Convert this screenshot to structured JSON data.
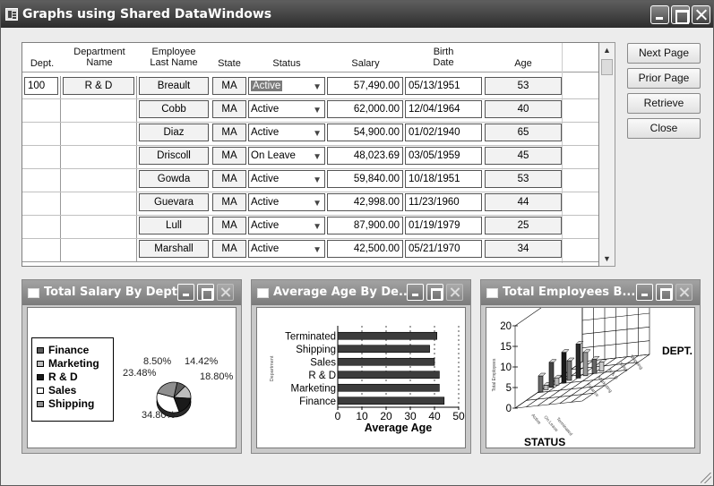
{
  "window": {
    "title": "Graphs using Shared DataWindows"
  },
  "grid": {
    "headers": {
      "dept": "Dept.",
      "department_name": [
        "Department",
        "Name"
      ],
      "employee_last_name": [
        "Employee",
        "Last Name"
      ],
      "state": "State",
      "status": "Status",
      "salary": "Salary",
      "birth_date": [
        "Birth",
        "Date"
      ],
      "age": "Age"
    },
    "dept_id": "100",
    "dept_name": "R & D",
    "rows": [
      {
        "last_name": "Breault",
        "state": "MA",
        "status": "Active",
        "salary": "57,490.00",
        "birth": "05/13/1951",
        "age": "53"
      },
      {
        "last_name": "Cobb",
        "state": "MA",
        "status": "Active",
        "salary": "62,000.00",
        "birth": "12/04/1964",
        "age": "40"
      },
      {
        "last_name": "Diaz",
        "state": "MA",
        "status": "Active",
        "salary": "54,900.00",
        "birth": "01/02/1940",
        "age": "65"
      },
      {
        "last_name": "Driscoll",
        "state": "MA",
        "status": "On Leave",
        "salary": "48,023.69",
        "birth": "03/05/1959",
        "age": "45"
      },
      {
        "last_name": "Gowda",
        "state": "MA",
        "status": "Active",
        "salary": "59,840.00",
        "birth": "10/18/1951",
        "age": "53"
      },
      {
        "last_name": "Guevara",
        "state": "MA",
        "status": "Active",
        "salary": "42,998.00",
        "birth": "11/23/1960",
        "age": "44"
      },
      {
        "last_name": "Lull",
        "state": "MA",
        "status": "Active",
        "salary": "87,900.00",
        "birth": "01/19/1979",
        "age": "25"
      },
      {
        "last_name": "Marshall",
        "state": "MA",
        "status": "Active",
        "salary": "42,500.00",
        "birth": "05/21/1970",
        "age": "34"
      }
    ]
  },
  "buttons": {
    "next_page": "Next Page",
    "prior_page": "Prior Page",
    "retrieve": "Retrieve",
    "close": "Close"
  },
  "panels": {
    "salary": {
      "title": "Total Salary By Dept."
    },
    "age": {
      "title": "Average Age By De..."
    },
    "employees": {
      "title": "Total Employees B..."
    }
  },
  "chart_data": [
    {
      "type": "pie",
      "title": "Total Salary By Dept.",
      "categories": [
        "Finance",
        "Marketing",
        "R & D",
        "Sales",
        "Shipping"
      ],
      "slice_labels": [
        "8.50%",
        "14.42%",
        "18.80%",
        "34.80%",
        "23.48%"
      ],
      "values": [
        8.5,
        14.42,
        18.8,
        34.8,
        23.48
      ],
      "colors": [
        "#5c5c5c",
        "#bdbdbd",
        "#1a1a1a",
        "#ffffff",
        "#8f8f8f"
      ],
      "legend_position": "left"
    },
    {
      "type": "bar",
      "orientation": "horizontal",
      "title": "Average Age By De...",
      "categories": [
        "Terminated",
        "Shipping",
        "Sales",
        "R & D",
        "Marketing",
        "Finance"
      ],
      "values": [
        41,
        38,
        40,
        42,
        42,
        44
      ],
      "xlabel": "Average Age",
      "ylabel": "Department",
      "xticks": [
        "0",
        "10",
        "20",
        "30",
        "40",
        "50"
      ],
      "xlim": [
        0,
        50
      ],
      "bar_color": "#3c3c3c"
    },
    {
      "type": "bar",
      "subtype": "3d",
      "title": "Total Employees B...",
      "xlabel": "STATUS",
      "ylabel": "Total Employees",
      "zlabel": "DEPT.",
      "yticks": [
        "0",
        "5",
        "10",
        "15",
        "20"
      ],
      "ylim": [
        0,
        20
      ]
    }
  ]
}
